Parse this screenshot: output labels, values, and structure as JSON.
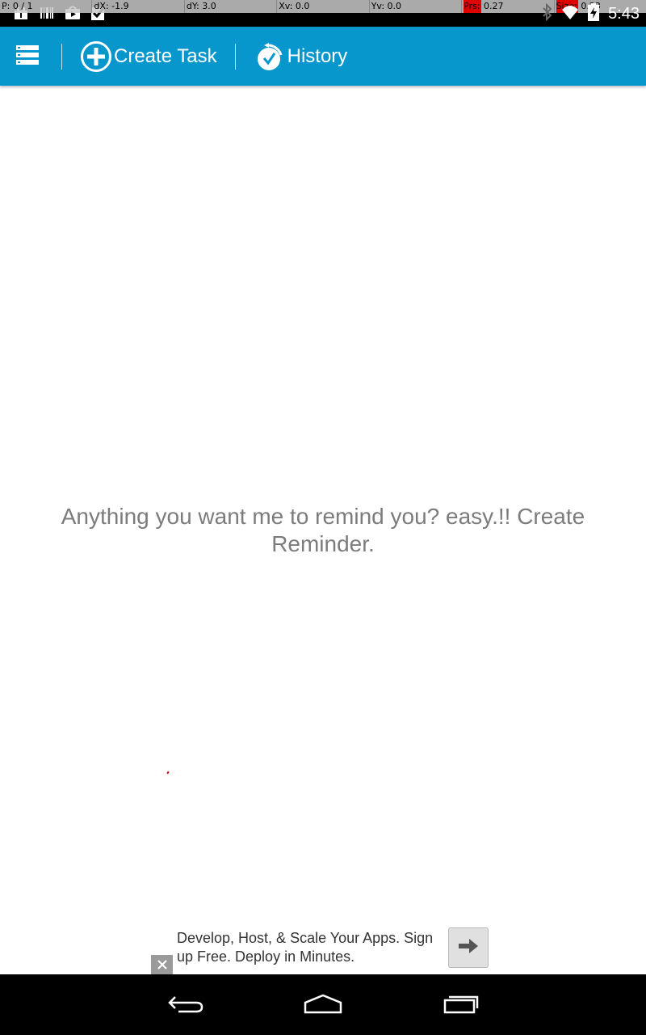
{
  "status_bar": {
    "pointer_location": [
      {
        "label": "P:",
        "value": " 0 / 1",
        "highlight": false
      },
      {
        "label": "dX:",
        "value": " -1.9",
        "highlight": false
      },
      {
        "label": "dY:",
        "value": " 3.0",
        "highlight": false
      },
      {
        "label": "Xv:",
        "value": " 0.0",
        "highlight": false
      },
      {
        "label": "Yv:",
        "value": " 0.0",
        "highlight": false
      },
      {
        "label": "Prs:",
        "value": " 0.27",
        "highlight": true
      },
      {
        "label": "Size:",
        "value": " 0.23",
        "highlight": true
      }
    ],
    "notification_icons": [
      "notification-icon",
      "barcode-icon",
      "play-store-icon",
      "checkbox-icon"
    ],
    "system_icons": [
      "bluetooth-icon",
      "wifi-icon",
      "battery-charging-icon"
    ],
    "time": "5:43"
  },
  "action_bar": {
    "background_color": "#0797cc",
    "menu_icon": "list-menu-icon",
    "create_task_label": "Create Task",
    "create_task_icon": "plus-circle-icon",
    "history_label": "History",
    "history_icon": "history-clock-icon"
  },
  "main": {
    "empty_message": "Anything you want me to remind you? easy.!! Create Reminder."
  },
  "ad": {
    "text": "Develop, Host, & Scale Your Apps. Sign up Free. Deploy in Minutes.",
    "close_icon": "close-x-icon",
    "cta_icon": "arrow-right-icon"
  },
  "nav_bar": {
    "back_icon": "back-icon",
    "home_icon": "home-icon",
    "recents_icon": "recents-icon"
  }
}
